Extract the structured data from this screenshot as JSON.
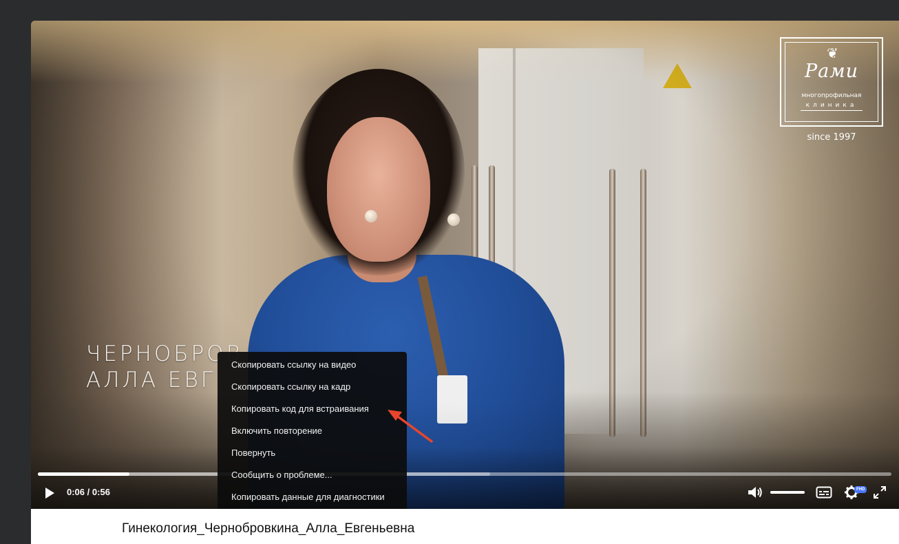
{
  "video": {
    "overlay_name_line1": "ЧЕРНОБРОВ",
    "overlay_name_line2": "АЛЛА ЕВГ",
    "logo": {
      "word": "Рами",
      "subtitle1": "многопрофильная",
      "subtitle2": "клиника",
      "since": "since 1997"
    }
  },
  "controls": {
    "current_time": "0:06",
    "separator": "/",
    "duration": "0:56",
    "played_fraction": 0.107,
    "buffered_fraction": 0.53,
    "volume_fraction": 1.0,
    "quality_badge": "FHD",
    "icons": [
      "play-icon",
      "volume-icon",
      "subtitles-icon",
      "settings-icon",
      "fullscreen-icon"
    ]
  },
  "context_menu": {
    "items": [
      "Скопировать ссылку на видео",
      "Скопировать ссылку на кадр",
      "Копировать код для встраивания",
      "Включить повторение",
      "Повернуть",
      "Сообщить о проблеме...",
      "Копировать данные для диагностики"
    ]
  },
  "info": {
    "title": "Гинекология_Чернобровкина_Алла_Евгеньевна",
    "meta": ""
  },
  "colors": {
    "annotation_arrow": "#e8452c",
    "page_background": "#2b2c2d",
    "quality_badge": "#4a77ff"
  }
}
